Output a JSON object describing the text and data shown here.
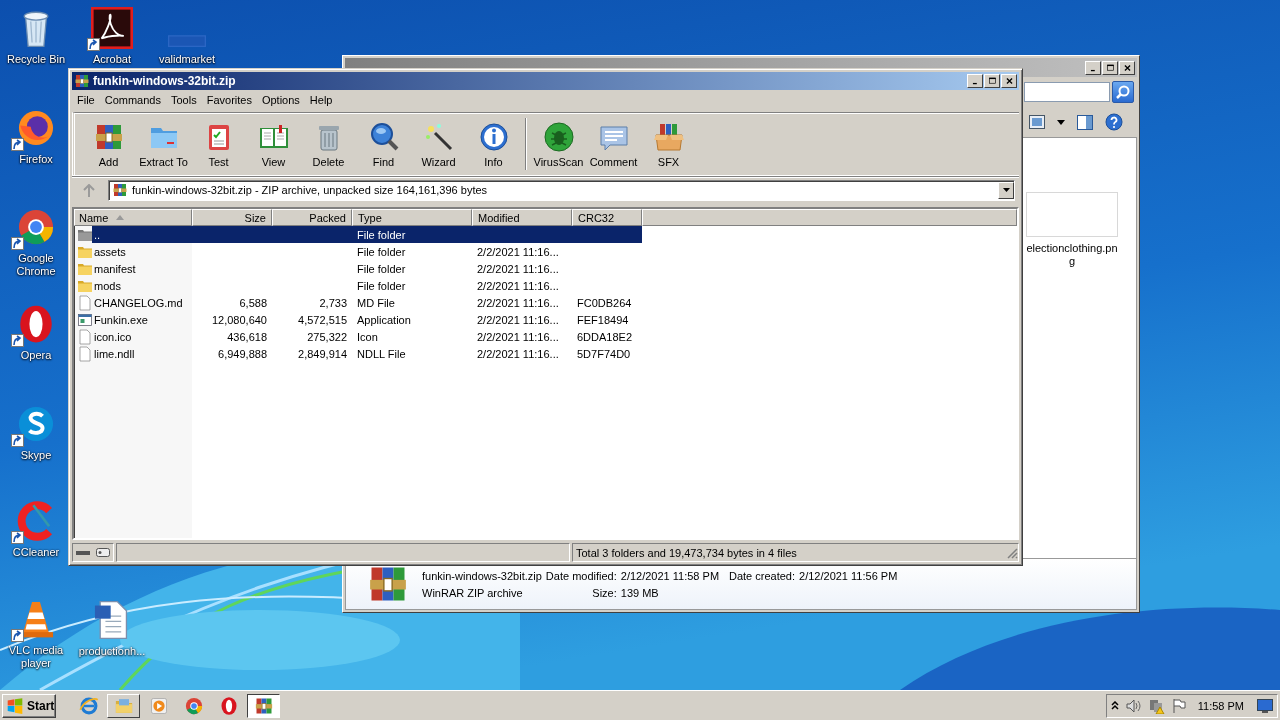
{
  "desktop_icons": [
    {
      "label": "Recycle Bin",
      "kind": "recycle",
      "shortcut": false
    },
    {
      "label": "Acrobat",
      "kind": "acrobat",
      "shortcut": true
    },
    {
      "label": "validmarket",
      "kind": "blank",
      "shortcut": false
    },
    {
      "label": "Firefox",
      "kind": "firefox",
      "shortcut": true
    },
    {
      "label": "Google Chrome",
      "kind": "chrome",
      "shortcut": true
    },
    {
      "label": "Opera",
      "kind": "opera",
      "shortcut": true
    },
    {
      "label": "Skype",
      "kind": "skype",
      "shortcut": true
    },
    {
      "label": "CCleaner",
      "kind": "ccleaner",
      "shortcut": true
    },
    {
      "label": "VLC media player",
      "kind": "vlc",
      "shortcut": true
    },
    {
      "label": "productionh...",
      "kind": "doc",
      "shortcut": false
    }
  ],
  "explorer": {
    "file_tile": {
      "label_lines": [
        "electionclothing.pn",
        "g"
      ]
    },
    "details": {
      "name": "funkin-windows-32bit.zip",
      "type": "WinRAR ZIP archive",
      "properties": [
        {
          "label": "Date modified:",
          "value": "2/12/2021 11:58 PM"
        },
        {
          "label": "Date created:",
          "value": "2/12/2021 11:56 PM"
        },
        {
          "label": "Size:",
          "value": "139 MB"
        }
      ]
    }
  },
  "winrar": {
    "title": "funkin-windows-32bit.zip",
    "menu": [
      "File",
      "Commands",
      "Tools",
      "Favorites",
      "Options",
      "Help"
    ],
    "toolbar_groups": [
      {
        "buttons": [
          {
            "label": "Add",
            "kind": "add"
          },
          {
            "label": "Extract To",
            "kind": "extract"
          },
          {
            "label": "Test",
            "kind": "test"
          },
          {
            "label": "View",
            "kind": "view"
          },
          {
            "label": "Delete",
            "kind": "delete"
          },
          {
            "label": "Find",
            "kind": "find"
          },
          {
            "label": "Wizard",
            "kind": "wizard"
          },
          {
            "label": "Info",
            "kind": "info"
          }
        ]
      },
      {
        "buttons": [
          {
            "label": "VirusScan",
            "kind": "virus"
          },
          {
            "label": "Comment",
            "kind": "comment"
          },
          {
            "label": "SFX",
            "kind": "sfx"
          }
        ]
      }
    ],
    "address": "funkin-windows-32bit.zip - ZIP archive, unpacked size 164,161,396 bytes",
    "columns": [
      {
        "label": "Name",
        "sorted": true
      },
      {
        "label": "Size",
        "sorted": false
      },
      {
        "label": "Packed",
        "sorted": false
      },
      {
        "label": "Type",
        "sorted": false
      },
      {
        "label": "Modified",
        "sorted": false
      },
      {
        "label": "CRC32",
        "sorted": false
      }
    ],
    "rows": [
      {
        "name": "..",
        "type": "File folder",
        "kind": "up",
        "selected": true
      },
      {
        "name": "assets",
        "type": "File folder",
        "modified": "2/2/2021 11:16...",
        "kind": "folder",
        "selected": false
      },
      {
        "name": "manifest",
        "type": "File folder",
        "modified": "2/2/2021 11:16...",
        "kind": "folder",
        "selected": false
      },
      {
        "name": "mods",
        "type": "File folder",
        "modified": "2/2/2021 11:16...",
        "kind": "folder",
        "selected": false
      },
      {
        "name": "CHANGELOG.md",
        "size": "6,588",
        "packed": "2,733",
        "type": "MD File",
        "modified": "2/2/2021 11:16...",
        "crc32": "FC0DB264",
        "kind": "file",
        "selected": false
      },
      {
        "name": "Funkin.exe",
        "size": "12,080,640",
        "packed": "4,572,515",
        "type": "Application",
        "modified": "2/2/2021 11:16...",
        "crc32": "FEF18494",
        "kind": "exe",
        "selected": false
      },
      {
        "name": "icon.ico",
        "size": "436,618",
        "packed": "275,322",
        "type": "Icon",
        "modified": "2/2/2021 11:16...",
        "crc32": "6DDA18E2",
        "kind": "file",
        "selected": false
      },
      {
        "name": "lime.ndll",
        "size": "6,949,888",
        "packed": "2,849,914",
        "type": "NDLL File",
        "modified": "2/2/2021 11:16...",
        "crc32": "5D7F74D0",
        "kind": "file",
        "selected": false
      }
    ],
    "status": "Total 3 folders and 19,473,734 bytes in 4 files"
  },
  "taskbar": {
    "start": "Start",
    "buttons": [
      {
        "kind": "ie",
        "window": false,
        "selected": false
      },
      {
        "kind": "explorer",
        "window": true,
        "selected": false
      },
      {
        "kind": "media",
        "window": false,
        "selected": false
      },
      {
        "kind": "chrome",
        "window": false,
        "selected": false
      },
      {
        "kind": "opera",
        "window": false,
        "selected": false
      },
      {
        "kind": "winrar",
        "window": true,
        "selected": true
      }
    ],
    "clock": "11:58 PM"
  }
}
